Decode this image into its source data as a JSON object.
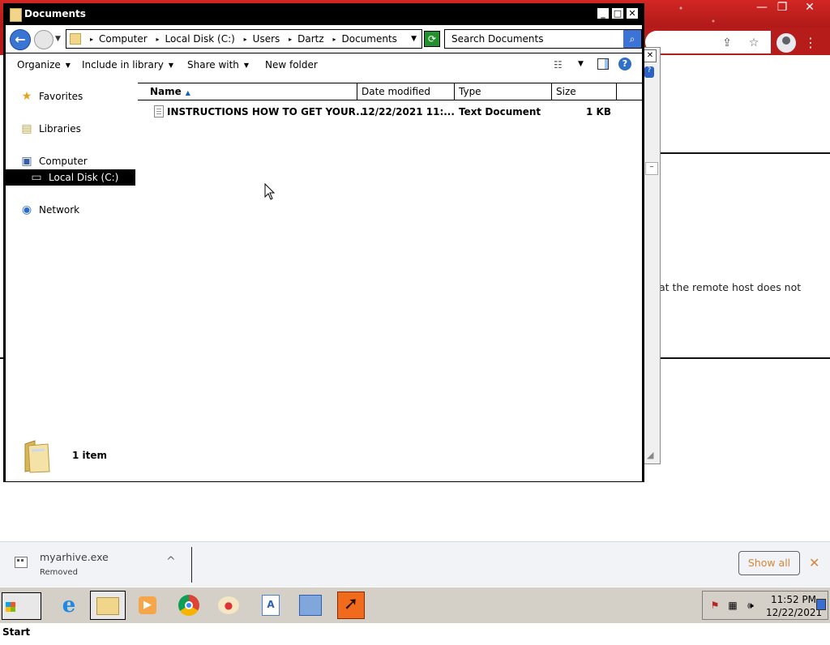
{
  "explorer": {
    "title": "Documents",
    "breadcrumbs": [
      "Computer",
      "Local Disk (C:)",
      "Users",
      "Dartz",
      "Documents"
    ],
    "search_placeholder": "Search Documents",
    "toolbar": {
      "organize": "Organize",
      "include_in_library": "Include in library",
      "share_with": "Share with",
      "new_folder": "New folder"
    },
    "nav": {
      "favorites": "Favorites",
      "libraries": "Libraries",
      "computer": "Computer",
      "local_disk": "Local Disk (C:)",
      "network": "Network"
    },
    "columns": [
      "Name",
      "Date modified",
      "Type",
      "Size"
    ],
    "files": [
      {
        "name": "INSTRUCTIONS HOW TO GET YOUR...",
        "date_modified": "12/22/2021 11:...",
        "type": "Text Document",
        "size": "1 KB"
      }
    ],
    "item_count": "1 item"
  },
  "chrome": {
    "error_fragment": "at the remote host does not"
  },
  "download_bar": {
    "filename": "myarhive.exe",
    "status": "Removed",
    "show_all": "Show all"
  },
  "taskbar": {
    "start_label": "Start",
    "clock_time": "11:52 PM",
    "clock_date": "12/22/2021"
  },
  "colors": {
    "chrome_frame": "#c8201e",
    "download_accent": "#d5873a"
  }
}
